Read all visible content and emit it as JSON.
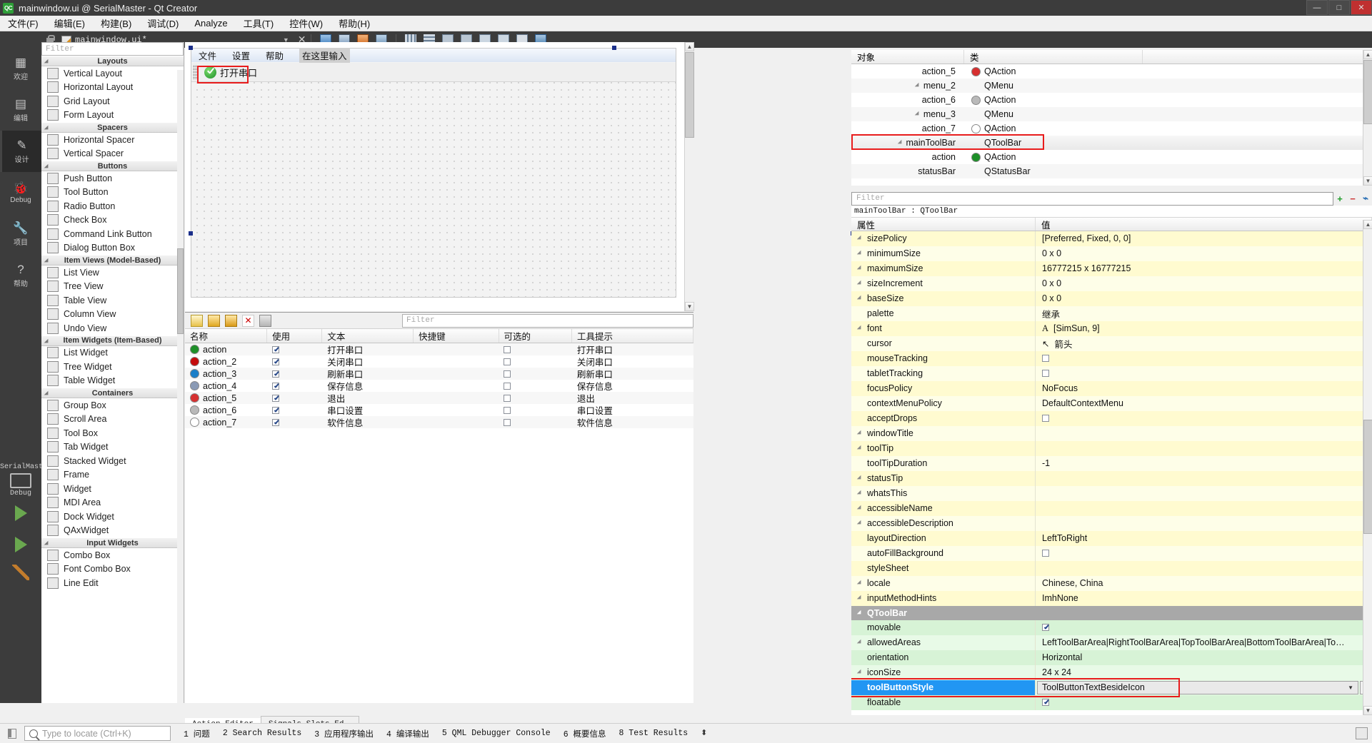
{
  "titlebar": {
    "logo": "QC",
    "title": "mainwindow.ui @ SerialMaster - Qt Creator",
    "minimize": "—",
    "maximize": "□",
    "close": "✕"
  },
  "menubar": {
    "items": [
      {
        "label": "文件(F)"
      },
      {
        "label": "编辑(E)"
      },
      {
        "label": "构建(B)"
      },
      {
        "label": "调试(D)"
      },
      {
        "label": "Analyze"
      },
      {
        "label": "工具(T)"
      },
      {
        "label": "控件(W)"
      },
      {
        "label": "帮助(H)"
      }
    ]
  },
  "doc_toolbar": {
    "filename": "mainwindow.ui*",
    "dropdown": "▼",
    "close": "✕"
  },
  "modebar": {
    "items": [
      {
        "glyph": "▦",
        "label": "欢迎",
        "active": false
      },
      {
        "glyph": "▤",
        "label": "编辑",
        "active": false
      },
      {
        "glyph": "✎",
        "label": "设计",
        "active": true
      },
      {
        "glyph": "🐞",
        "label": "Debug",
        "active": false
      },
      {
        "glyph": "🔧",
        "label": "项目",
        "active": false
      },
      {
        "glyph": "?",
        "label": "帮助",
        "active": false
      }
    ],
    "project_name": "SerialMaster",
    "kit_label": "Debug"
  },
  "widgetbox": {
    "filter_placeholder": "Filter",
    "groups": [
      {
        "title": "Layouts",
        "items": [
          {
            "label": "Vertical Layout",
            "icon": "vertical-layout-icon"
          },
          {
            "label": "Horizontal Layout",
            "icon": "horizontal-layout-icon"
          },
          {
            "label": "Grid Layout",
            "icon": "grid-layout-icon"
          },
          {
            "label": "Form Layout",
            "icon": "form-layout-icon"
          }
        ]
      },
      {
        "title": "Spacers",
        "items": [
          {
            "label": "Horizontal Spacer",
            "icon": "horizontal-spacer-icon"
          },
          {
            "label": "Vertical Spacer",
            "icon": "vertical-spacer-icon"
          }
        ]
      },
      {
        "title": "Buttons",
        "items": [
          {
            "label": "Push Button",
            "icon": "push-button-icon"
          },
          {
            "label": "Tool Button",
            "icon": "tool-button-icon"
          },
          {
            "label": "Radio Button",
            "icon": "radio-button-icon"
          },
          {
            "label": "Check Box",
            "icon": "check-box-icon"
          },
          {
            "label": "Command Link Button",
            "icon": "command-link-icon"
          },
          {
            "label": "Dialog Button Box",
            "icon": "dialog-button-box-icon"
          }
        ]
      },
      {
        "title": "Item Views (Model-Based)",
        "items": [
          {
            "label": "List View",
            "icon": "list-view-icon"
          },
          {
            "label": "Tree View",
            "icon": "tree-view-icon"
          },
          {
            "label": "Table View",
            "icon": "table-view-icon"
          },
          {
            "label": "Column View",
            "icon": "column-view-icon"
          },
          {
            "label": "Undo View",
            "icon": "undo-view-icon"
          }
        ]
      },
      {
        "title": "Item Widgets (Item-Based)",
        "items": [
          {
            "label": "List Widget",
            "icon": "list-widget-icon"
          },
          {
            "label": "Tree Widget",
            "icon": "tree-widget-icon"
          },
          {
            "label": "Table Widget",
            "icon": "table-widget-icon"
          }
        ]
      },
      {
        "title": "Containers",
        "items": [
          {
            "label": "Group Box",
            "icon": "group-box-icon"
          },
          {
            "label": "Scroll Area",
            "icon": "scroll-area-icon"
          },
          {
            "label": "Tool Box",
            "icon": "tool-box-icon"
          },
          {
            "label": "Tab Widget",
            "icon": "tab-widget-icon"
          },
          {
            "label": "Stacked Widget",
            "icon": "stacked-widget-icon"
          },
          {
            "label": "Frame",
            "icon": "frame-icon"
          },
          {
            "label": "Widget",
            "icon": "widget-icon"
          },
          {
            "label": "MDI Area",
            "icon": "mdi-area-icon"
          },
          {
            "label": "Dock Widget",
            "icon": "dock-widget-icon"
          },
          {
            "label": "QAxWidget",
            "icon": "qaxwidget-icon"
          }
        ]
      },
      {
        "title": "Input Widgets",
        "items": [
          {
            "label": "Combo Box",
            "icon": "combo-box-icon"
          },
          {
            "label": "Font Combo Box",
            "icon": "font-combo-box-icon"
          },
          {
            "label": "Line Edit",
            "icon": "line-edit-icon"
          }
        ]
      }
    ]
  },
  "form_editor": {
    "menu_items": [
      "文件",
      "设置",
      "帮助"
    ],
    "menu_hint": "在这里输入",
    "toolbar_action_label": "打开串口"
  },
  "action_editor": {
    "filter_placeholder": "Filter",
    "columns": [
      "名称",
      "使用",
      "文本",
      "快捷键",
      "可选的",
      "工具提示"
    ],
    "rows": [
      {
        "name": "action",
        "used": true,
        "text": "打开串口",
        "shortcut": "",
        "checkable": false,
        "tooltip": "打开串口",
        "icon_color": "#1d8f28"
      },
      {
        "name": "action_2",
        "used": true,
        "text": "关闭串口",
        "shortcut": "",
        "checkable": false,
        "tooltip": "关闭串口",
        "icon_color": "#c40c0c"
      },
      {
        "name": "action_3",
        "used": true,
        "text": "刷新串口",
        "shortcut": "",
        "checkable": false,
        "tooltip": "刷新串口",
        "icon_color": "#1a7ec8"
      },
      {
        "name": "action_4",
        "used": true,
        "text": "保存信息",
        "shortcut": "",
        "checkable": false,
        "tooltip": "保存信息",
        "icon_color": "#8a9ab5"
      },
      {
        "name": "action_5",
        "used": true,
        "text": "退出",
        "shortcut": "",
        "checkable": false,
        "tooltip": "退出",
        "icon_color": "#d63030"
      },
      {
        "name": "action_6",
        "used": true,
        "text": "串口设置",
        "shortcut": "",
        "checkable": false,
        "tooltip": "串口设置",
        "icon_color": "#b9b9b9"
      },
      {
        "name": "action_7",
        "used": true,
        "text": "软件信息",
        "shortcut": "",
        "checkable": false,
        "tooltip": "软件信息",
        "icon_color": "#ffffff"
      }
    ],
    "tabs": [
      {
        "label": "Action Editor",
        "selected": true
      },
      {
        "label": "Signals  Slots Ed⋯",
        "selected": false
      }
    ]
  },
  "object_inspector": {
    "columns": [
      "对象",
      "类"
    ],
    "rows": [
      {
        "name": "action_5",
        "cls": "QAction",
        "indent": 3,
        "expandable": false,
        "icon_color": "#d63030",
        "highlighted": false
      },
      {
        "name": "menu_2",
        "cls": "QMenu",
        "indent": 2,
        "expandable": true,
        "icon_color": "",
        "highlighted": false
      },
      {
        "name": "action_6",
        "cls": "QAction",
        "indent": 3,
        "expandable": false,
        "icon_color": "#b9b9b9",
        "highlighted": false
      },
      {
        "name": "menu_3",
        "cls": "QMenu",
        "indent": 2,
        "expandable": true,
        "icon_color": "",
        "highlighted": false
      },
      {
        "name": "action_7",
        "cls": "QAction",
        "indent": 3,
        "expandable": false,
        "icon_color": "#ffffff",
        "highlighted": false
      },
      {
        "name": "mainToolBar",
        "cls": "QToolBar",
        "indent": 1,
        "expandable": true,
        "icon_color": "",
        "highlighted": true
      },
      {
        "name": "action",
        "cls": "QAction",
        "indent": 2,
        "expandable": false,
        "icon_color": "#1d8f28",
        "highlighted": false
      },
      {
        "name": "statusBar",
        "cls": "QStatusBar",
        "indent": 1,
        "expandable": false,
        "icon_color": "",
        "highlighted": false
      }
    ]
  },
  "property_editor": {
    "filter_placeholder": "Filter",
    "add_label": "+",
    "remove_label": "−",
    "config_label": "⌁",
    "object_header": "mainToolBar : QToolBar",
    "columns": [
      "属性",
      "值"
    ],
    "rows": [
      {
        "key": "sizePolicy",
        "value": "[Preferred, Fixed, 0, 0]",
        "expandable": true,
        "kind": "text",
        "band": "y1"
      },
      {
        "key": "minimumSize",
        "value": "0 x 0",
        "expandable": true,
        "kind": "text",
        "band": "y1"
      },
      {
        "key": "maximumSize",
        "value": "16777215 x 16777215",
        "expandable": true,
        "kind": "text",
        "band": "y1"
      },
      {
        "key": "sizeIncrement",
        "value": "0 x 0",
        "expandable": true,
        "kind": "text",
        "band": "y1"
      },
      {
        "key": "baseSize",
        "value": "0 x 0",
        "expandable": true,
        "kind": "text",
        "band": "y1"
      },
      {
        "key": "palette",
        "value": "继承",
        "expandable": false,
        "kind": "text",
        "band": "y1"
      },
      {
        "key": "font",
        "value": "[SimSun, 9]",
        "expandable": true,
        "kind": "font",
        "band": "y1"
      },
      {
        "key": "cursor",
        "value": "箭头",
        "expandable": false,
        "kind": "cursor",
        "band": "y1"
      },
      {
        "key": "mouseTracking",
        "value": "",
        "expandable": false,
        "kind": "check",
        "band": "y1",
        "checked": false
      },
      {
        "key": "tabletTracking",
        "value": "",
        "expandable": false,
        "kind": "check",
        "band": "y1",
        "checked": false
      },
      {
        "key": "focusPolicy",
        "value": "NoFocus",
        "expandable": false,
        "kind": "text",
        "band": "y1"
      },
      {
        "key": "contextMenuPolicy",
        "value": "DefaultContextMenu",
        "expandable": false,
        "kind": "text",
        "band": "y1"
      },
      {
        "key": "acceptDrops",
        "value": "",
        "expandable": false,
        "kind": "check",
        "band": "y1",
        "checked": false
      },
      {
        "key": "windowTitle",
        "value": "",
        "expandable": true,
        "kind": "text",
        "band": "y1"
      },
      {
        "key": "toolTip",
        "value": "",
        "expandable": true,
        "kind": "text",
        "band": "y1"
      },
      {
        "key": "toolTipDuration",
        "value": "-1",
        "expandable": false,
        "kind": "text",
        "band": "y1"
      },
      {
        "key": "statusTip",
        "value": "",
        "expandable": true,
        "kind": "text",
        "band": "y1"
      },
      {
        "key": "whatsThis",
        "value": "",
        "expandable": true,
        "kind": "text",
        "band": "y1"
      },
      {
        "key": "accessibleName",
        "value": "",
        "expandable": true,
        "kind": "text",
        "band": "y1"
      },
      {
        "key": "accessibleDescription",
        "value": "",
        "expandable": true,
        "kind": "text",
        "band": "y1"
      },
      {
        "key": "layoutDirection",
        "value": "LeftToRight",
        "expandable": false,
        "kind": "text",
        "band": "y1"
      },
      {
        "key": "autoFillBackground",
        "value": "",
        "expandable": false,
        "kind": "check",
        "band": "y1",
        "checked": false
      },
      {
        "key": "styleSheet",
        "value": "",
        "expandable": false,
        "kind": "text",
        "band": "y1"
      },
      {
        "key": "locale",
        "value": "Chinese, China",
        "expandable": true,
        "kind": "text",
        "band": "y1"
      },
      {
        "key": "inputMethodHints",
        "value": "ImhNone",
        "expandable": true,
        "kind": "text",
        "band": "y1"
      }
    ],
    "group_label": "QToolBar",
    "group_rows": [
      {
        "key": "movable",
        "value": "",
        "expandable": false,
        "kind": "check",
        "band": "g1",
        "checked": true
      },
      {
        "key": "allowedAreas",
        "value": "LeftToolBarArea|RightToolBarArea|TopToolBarArea|BottomToolBarArea|To…",
        "expandable": true,
        "kind": "text",
        "band": "g1"
      },
      {
        "key": "orientation",
        "value": "Horizontal",
        "expandable": false,
        "kind": "text",
        "band": "g1"
      },
      {
        "key": "iconSize",
        "value": "24 x 24",
        "expandable": true,
        "kind": "text",
        "band": "g1"
      }
    ],
    "selected_row": {
      "key": "toolButtonStyle",
      "value": "ToolButtonTextBesideIcon",
      "caret": "▼",
      "reset": "↰"
    },
    "last_row": {
      "key": "floatable",
      "value": "",
      "kind": "check",
      "checked": true
    }
  },
  "statusbar": {
    "search_placeholder": "Type to locate (Ctrl+K)",
    "items": [
      {
        "label": "1 问题"
      },
      {
        "label": "2 Search Results"
      },
      {
        "label": "3 应用程序输出"
      },
      {
        "label": "4 编译输出"
      },
      {
        "label": "5 QML Debugger Console"
      },
      {
        "label": "6 概要信息"
      },
      {
        "label": "8 Test Results"
      }
    ],
    "updown": "⬍"
  }
}
